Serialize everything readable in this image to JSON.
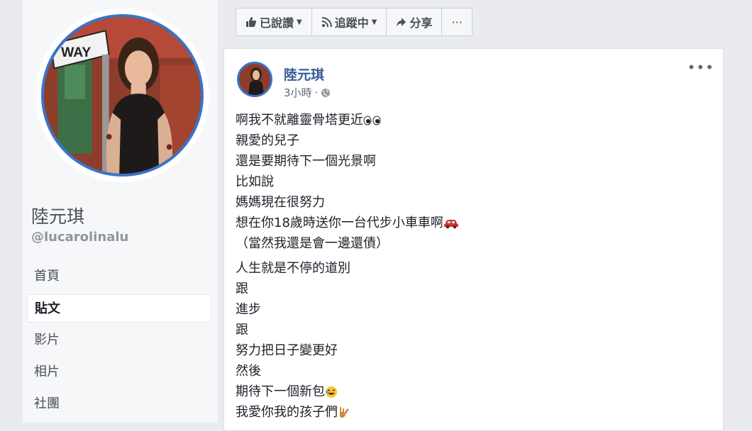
{
  "profile": {
    "name": "陸元琪",
    "handle": "@lucarolinalu",
    "photo_sign_text": "WAY"
  },
  "nav": [
    {
      "label": "首頁",
      "active": false
    },
    {
      "label": "貼文",
      "active": true
    },
    {
      "label": "影片",
      "active": false
    },
    {
      "label": "相片",
      "active": false
    },
    {
      "label": "社團",
      "active": false
    }
  ],
  "toolbar": {
    "liked_label": "已說讚",
    "following_label": "追蹤中",
    "share_label": "分享",
    "more_label": "···"
  },
  "post": {
    "author": "陸元琪",
    "time": "3小時",
    "separator": "·",
    "more_label": "•••",
    "lines": [
      "啊我不就離靈骨塔更近",
      "親愛的兒子",
      "還是要期待下一個光景啊",
      "比如說",
      "媽媽現在很努力",
      "想在你18歲時送你一台代步小車車啊",
      "（當然我還是會一邊還債）",
      "人生就是不停的道別",
      "跟",
      "進步",
      "跟",
      "努力把日子變更好",
      "然後",
      "期待下一個新包",
      "我愛你我的孩子們"
    ]
  },
  "icons": {
    "like": "thumbs-up-icon",
    "follow": "rss-icon",
    "share": "share-arrow-icon",
    "privacy": "globe-icon"
  },
  "colors": {
    "link": "#365899",
    "ring": "#3b73c9",
    "background": "#e9ebee"
  }
}
